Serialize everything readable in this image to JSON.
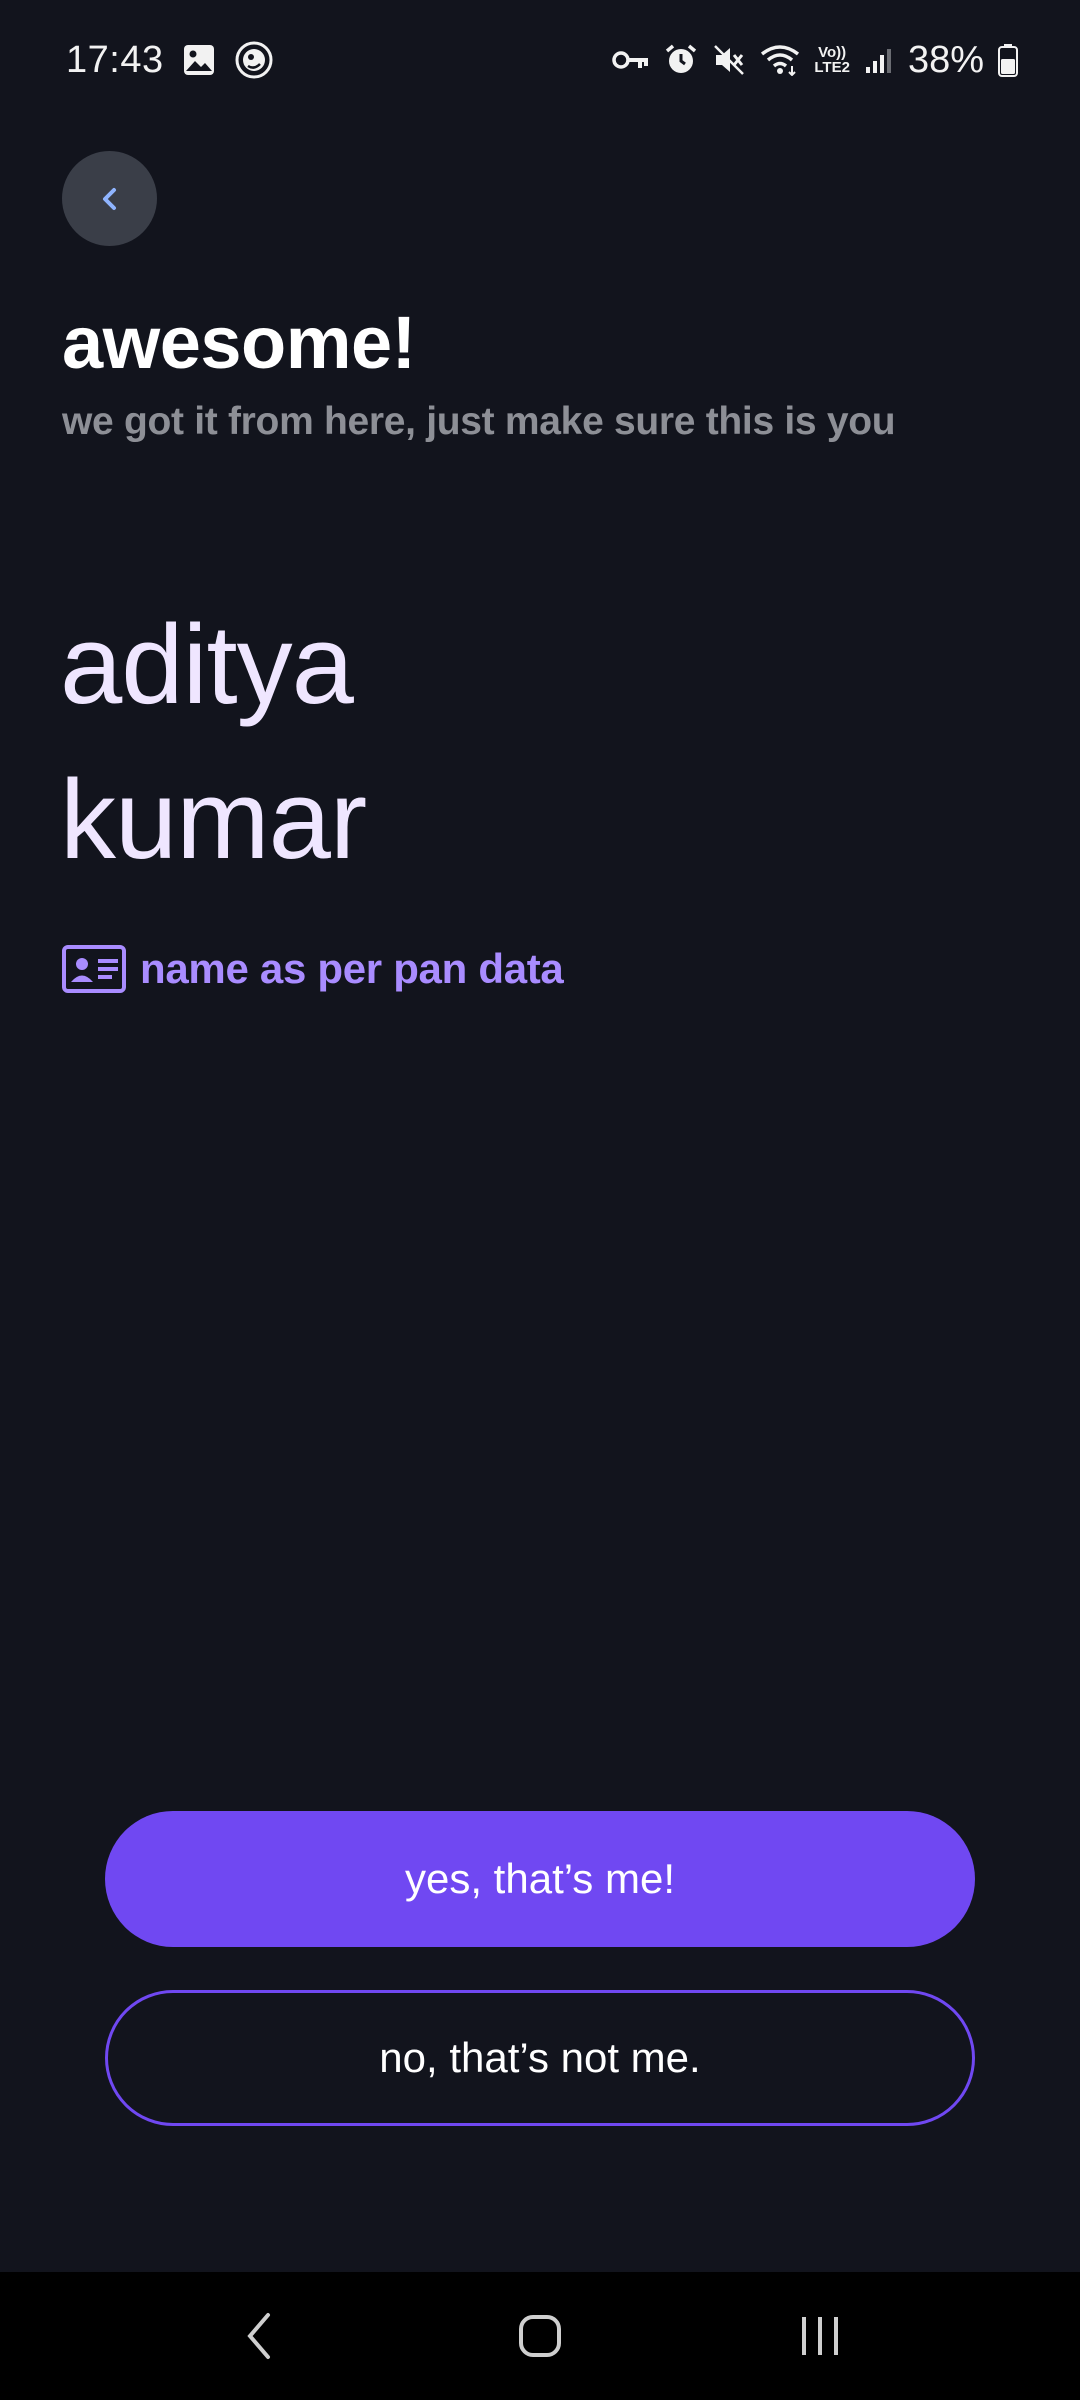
{
  "status_bar": {
    "time": "17:43",
    "battery": "38%",
    "left_icons": [
      "image-icon",
      "app-notification-icon"
    ],
    "right_icons": [
      "vpn-key-icon",
      "alarm-icon",
      "mute-icon",
      "wifi-icon",
      "volte-icon",
      "signal-icon",
      "battery-icon"
    ],
    "volte_text_top": "Vo))",
    "volte_text_bottom": "LTE2"
  },
  "header": {
    "back_icon": "chevron-left-icon",
    "title": "awesome!",
    "subtitle": "we got it from here, just make sure this is you"
  },
  "identity": {
    "first_name": "aditya",
    "last_name": "kumar",
    "source_icon": "id-card-icon",
    "source_label": "name as per pan data"
  },
  "actions": {
    "confirm_label": "yes, that’s me!",
    "reject_label": "no, that’s not me."
  },
  "nav_bar": {
    "icons": [
      "nav-back-icon",
      "nav-home-icon",
      "nav-recents-icon"
    ]
  },
  "colors": {
    "background": "#12141d",
    "accent": "#7048f2",
    "name_text": "#efe6ff",
    "label_accent": "#a98cff",
    "subtitle_text": "#8d8f96"
  }
}
